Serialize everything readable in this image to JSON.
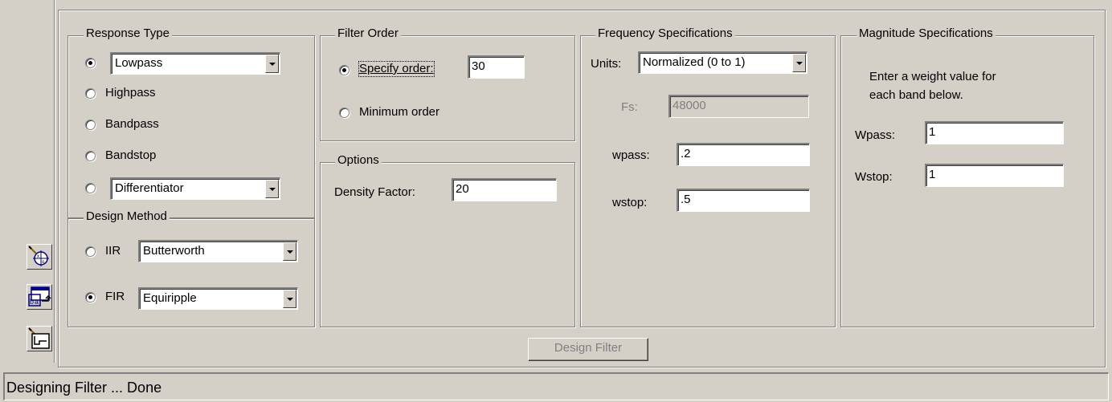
{
  "response_type": {
    "title": "Response Type",
    "lowpass": "Lowpass",
    "highpass": "Highpass",
    "bandpass": "Bandpass",
    "bandstop": "Bandstop",
    "differentiator": "Differentiator",
    "selected": "Lowpass"
  },
  "design_method": {
    "title": "Design Method",
    "iir_label": "IIR",
    "iir_value": "Butterworth",
    "fir_label": "FIR",
    "fir_value": "Equiripple",
    "selected": "FIR"
  },
  "filter_order": {
    "title": "Filter Order",
    "specify_label": "Specify order:",
    "order_value": "30",
    "minimum_label": "Minimum order",
    "selected": "Specify order"
  },
  "options": {
    "title": "Options",
    "density_label": "Density Factor:",
    "density_value": "20"
  },
  "frequency": {
    "title": "Frequency Specifications",
    "units_label": "Units:",
    "units_value": "Normalized (0 to 1)",
    "fs_label": "Fs:",
    "fs_value": "48000",
    "wpass_label": "wpass:",
    "wpass_value": ".2",
    "wstop_label": "wstop:",
    "wstop_value": ".5"
  },
  "magnitude": {
    "title": "Magnitude Specifications",
    "instruction_line1": "Enter a weight value for",
    "instruction_line2": "each band below.",
    "wpass_label": "Wpass:",
    "wpass_value": "1",
    "wstop_label": "Wstop:",
    "wstop_value": "1"
  },
  "design_button": "Design Filter",
  "status": "Designing Filter ... Done",
  "toolbar_icons": [
    "pole-zero-editor-icon",
    "import-filter-icon",
    "design-filter-icon"
  ]
}
